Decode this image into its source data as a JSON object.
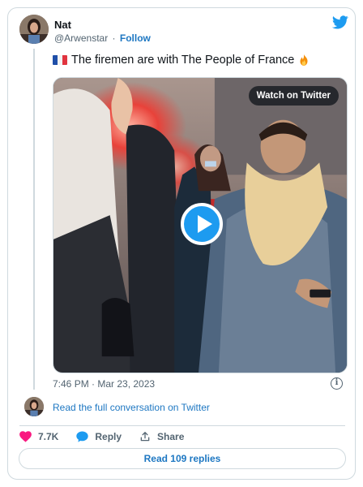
{
  "author": {
    "name": "Nat",
    "handle": "@Arwenstar",
    "separator": "·",
    "follow_label": "Follow"
  },
  "tweet": {
    "text": "The firemen are with The People of France",
    "flag_colors": [
      "#1f4fa8",
      "#ffffff",
      "#e1343f"
    ],
    "trailing_icon": "fire-emoji-icon"
  },
  "media": {
    "watch_label": "Watch on Twitter",
    "play_icon": "play-icon"
  },
  "timestamp": "7:46 PM · Mar 23, 2023",
  "conversation_link": "Read the full conversation on Twitter",
  "actions": {
    "likes_count": "7.7K",
    "reply_label": "Reply",
    "share_label": "Share"
  },
  "read_replies_label": "Read 109 replies",
  "colors": {
    "accent": "#1d9bf0",
    "link": "#1d77c2",
    "like": "#f91880",
    "border": "#cfd9de"
  }
}
